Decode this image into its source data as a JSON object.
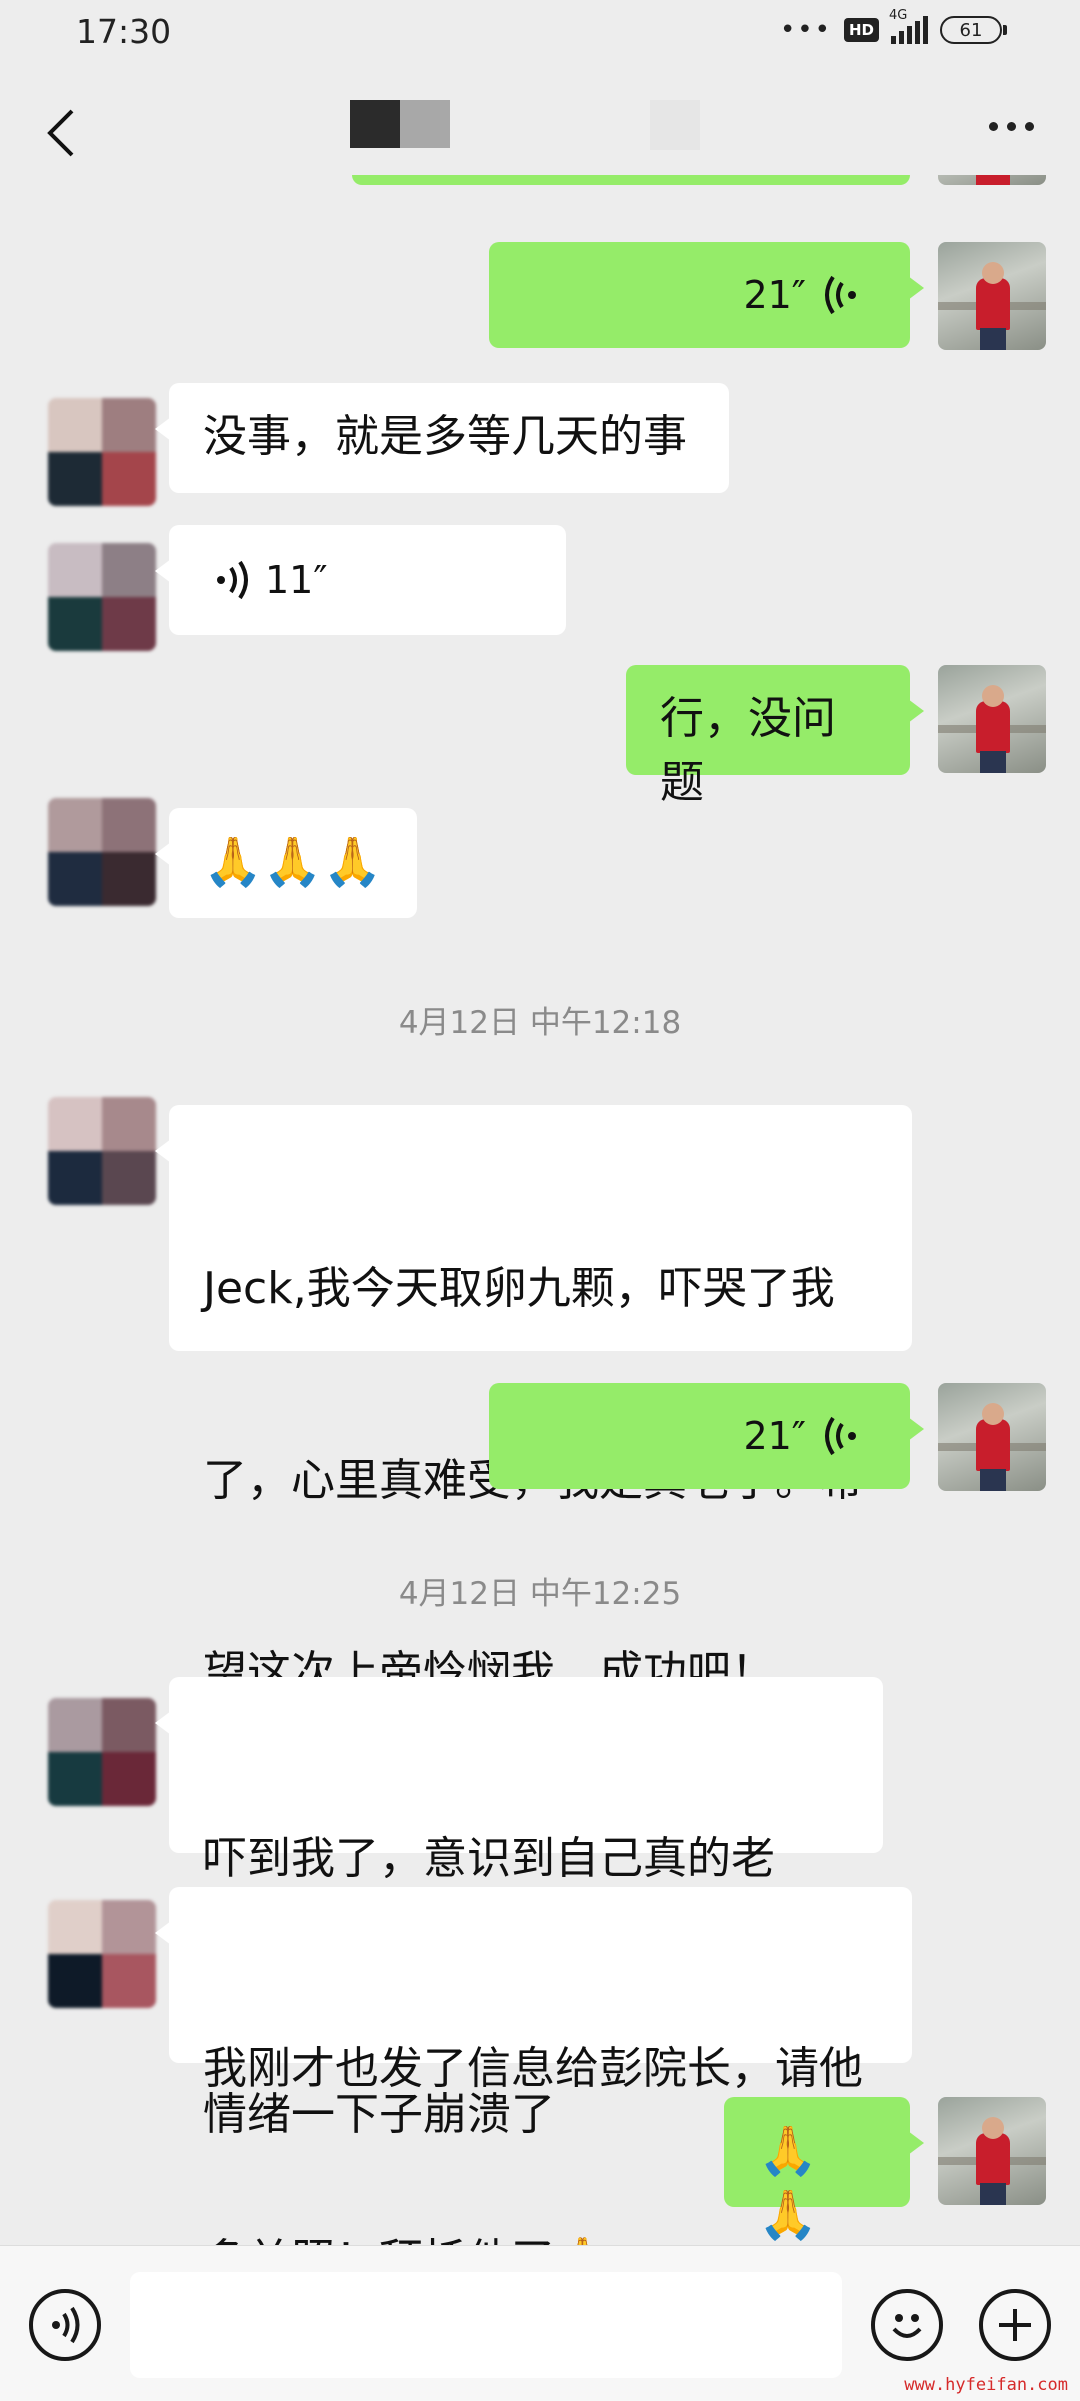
{
  "status_bar": {
    "time": "17:30",
    "hd_label": "HD",
    "network": "4G",
    "battery": "61"
  },
  "header": {
    "back_icon": "chevron-left-icon",
    "more_icon": "more-dots-icon"
  },
  "messages": [
    {
      "side": "out",
      "type": "voice",
      "duration": "21″"
    },
    {
      "side": "in",
      "type": "text",
      "text": "没事，就是多等几天的事"
    },
    {
      "side": "in",
      "type": "voice",
      "duration": "11″"
    },
    {
      "side": "out",
      "type": "text",
      "text": "行，没问题"
    },
    {
      "side": "in",
      "type": "text",
      "text": "🙏🙏🙏"
    },
    {
      "type": "timestamp",
      "text": "4月12日 中午12:18"
    },
    {
      "side": "in",
      "type": "text",
      "text": "Jeck,我今天取卵九颗，吓哭了我了，心里真难受，我是真老了。希望这次上帝怜悯我，成功吧！"
    },
    {
      "side": "out",
      "type": "voice",
      "duration": "21″"
    },
    {
      "type": "timestamp",
      "text": "4月12日 中午12:25"
    },
    {
      "side": "in",
      "type": "text",
      "text": "吓到我了，意识到自己真的老了，情绪一下子崩溃了"
    },
    {
      "side": "in",
      "type": "text",
      "text": "我刚才也发了信息给彭院长，请他多关照！拜托他了🙏"
    },
    {
      "side": "out",
      "type": "text",
      "text": "🙏🙏"
    }
  ],
  "display_lines": {
    "m1": "没事，就是多等几天的事",
    "m3": "行，没问题",
    "m4": "🙏🙏🙏",
    "m6_l1": "Jeck,我今天取卵九颗，吓哭了我",
    "m6_l2": "了，心里真难受，我是真老了。希",
    "m6_l3": "望这次上帝怜悯我，成功吧！",
    "m9_l1": "吓到我了，意识到自己真的老了，",
    "m9_l2": "情绪一下子崩溃了",
    "m10_l1": "我刚才也发了信息给彭院长，请他",
    "m10_l2": "多关照！拜托他了🙏",
    "m11": "🙏🙏"
  },
  "bottom_bar": {
    "voice_icon": "voice-input-icon",
    "emoji_icon": "emoji-icon",
    "plus_icon": "plus-icon"
  },
  "watermark": "www.hyfeifan.com",
  "colors": {
    "background": "#ededed",
    "outgoing_bubble": "#95ec69",
    "incoming_bubble": "#ffffff"
  }
}
